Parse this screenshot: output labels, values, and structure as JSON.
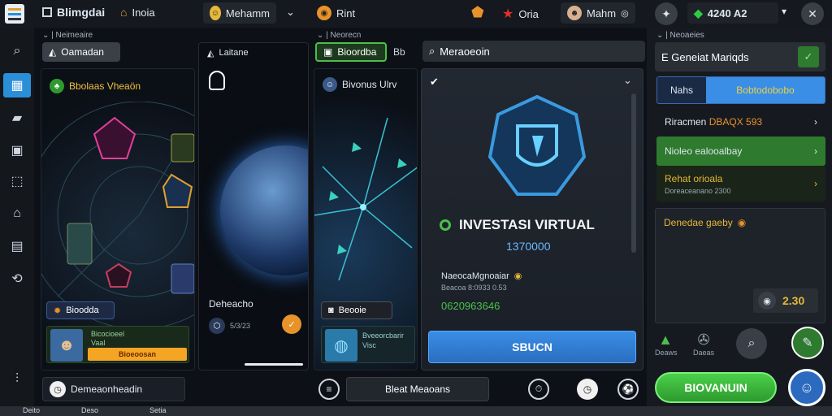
{
  "colors": {
    "accent": "#2b8fd8",
    "green": "#2e9a2e",
    "orange": "#e8922a",
    "gold": "#e6b83a",
    "panel": "#1b1f26"
  },
  "topbar": {
    "app_title": "Blimgdai",
    "nav_item": "Inoia",
    "profile_name": "Mehamm",
    "tab_label": "Rint",
    "user_label": "Oria",
    "user_menu": "Mahm",
    "balance": "4240 A2"
  },
  "column1": {
    "breadcrumb": "Neimeaire",
    "tab_button": "Oamadan",
    "card_title": "Bbolaas Vheaön",
    "badge_label": "Bioodda",
    "card_line1": "Bicocioeel",
    "card_line2": "Vaal",
    "orange_btn": "Bioeoosan",
    "footer_label": "Demeaonheadin"
  },
  "column2": {
    "header": "Laitane",
    "card_caption": "Deheacho",
    "sub_caption": "5/3/23"
  },
  "column3": {
    "breadcrumb": "Neorecn",
    "tab_active": "Bioordba",
    "tab_inactive": "Bb",
    "card_title": "Bivonus Ulrv",
    "badge_label": "Beooie",
    "card_line1": "Bveeorcbarir",
    "card_line2": "Visc",
    "footer_btn": "Bleat Meaoans"
  },
  "column4": {
    "search_label": "Meraoeoin",
    "headline": "INVESTASI VIRTUAL",
    "value": "1370000",
    "line_label": "Naeoca",
    "line_value": "NaeocaMgnoaiar",
    "line_sub": "Beacoa 8:0933 0.53",
    "amount": "0620963646",
    "action_btn": "SBUCN"
  },
  "right_panel": {
    "breadcrumb": "Neoaeies",
    "header": "E Geneiat Mariqds",
    "tab_left": "Nahs",
    "tab_right": "Bobtodobobo",
    "row1": "Riracmen",
    "row1_value": "DBAQX 593",
    "row2": "Nioleo ealooalbay",
    "row3": "Rehat orioala",
    "row3_sub": "Doreaceanano 2300",
    "sub_header": "Denedae gaeby",
    "price": "2.30",
    "shortcut1": "Deaws",
    "shortcut2": "Daeas",
    "main_btn": "BIOVANUIN"
  },
  "taskbar": {
    "item1": "Deito",
    "item2": "Deso",
    "item3": "Setia"
  }
}
